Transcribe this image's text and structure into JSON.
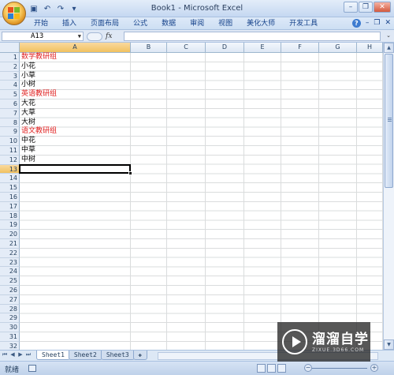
{
  "window": {
    "title": "Book1 - Microsoft Excel"
  },
  "qat": {
    "save_icon": "save-icon",
    "undo_icon": "undo-icon",
    "redo_icon": "redo-icon"
  },
  "ribbon": {
    "tabs": [
      "开始",
      "插入",
      "页面布局",
      "公式",
      "数据",
      "审阅",
      "视图",
      "美化大师",
      "开发工具"
    ]
  },
  "formula_bar": {
    "name_box": "A13",
    "fx_label": "fx",
    "formula": ""
  },
  "columns": [
    "A",
    "B",
    "C",
    "D",
    "E",
    "F",
    "G",
    "H"
  ],
  "rows": [
    "1",
    "2",
    "3",
    "4",
    "5",
    "6",
    "7",
    "8",
    "9",
    "10",
    "11",
    "12",
    "13",
    "14",
    "15",
    "16",
    "17",
    "18",
    "19",
    "20",
    "21",
    "22",
    "23",
    "24",
    "25",
    "26",
    "27",
    "28",
    "29",
    "30",
    "31",
    "32"
  ],
  "cells_A": [
    {
      "text": "数学教研组",
      "red": true
    },
    {
      "text": "小花",
      "red": false
    },
    {
      "text": "小草",
      "red": false
    },
    {
      "text": "小树",
      "red": false
    },
    {
      "text": "英语教研组",
      "red": true
    },
    {
      "text": "大花",
      "red": false
    },
    {
      "text": "大草",
      "red": false
    },
    {
      "text": "大树",
      "red": false
    },
    {
      "text": "语文教研组",
      "red": true
    },
    {
      "text": "中花",
      "red": false
    },
    {
      "text": "中草",
      "red": false
    },
    {
      "text": "中树",
      "red": false
    }
  ],
  "selected_cell": "A13",
  "sheet_tabs": [
    "Sheet1",
    "Sheet2",
    "Sheet3"
  ],
  "status": {
    "ready": "就绪"
  },
  "colors": {
    "red_text": "#e02020",
    "accent": "#15428b"
  },
  "watermark": {
    "main": "溜溜自学",
    "sub": "ZIXUE.3D66.COM"
  }
}
